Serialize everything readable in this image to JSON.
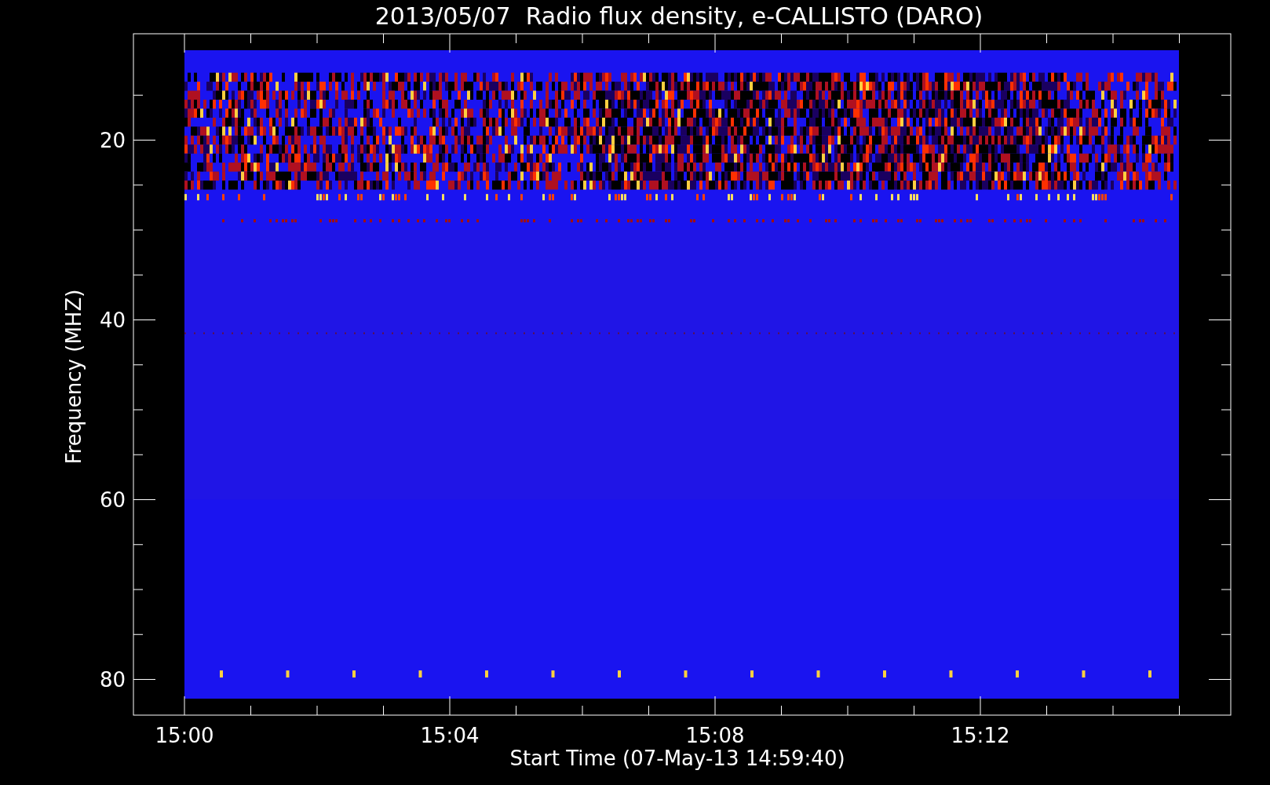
{
  "plot": {
    "title": "2013/05/07  Radio flux density, e-CALLISTO (DARO)",
    "xlabel": "Start Time (07-May-13 14:59:40)",
    "ylabel": "Frequency (MHZ)",
    "x_tick_labels": [
      "15:00",
      "15:04",
      "15:08",
      "15:12"
    ],
    "y_tick_labels": [
      "20",
      "40",
      "60",
      "80"
    ]
  }
}
